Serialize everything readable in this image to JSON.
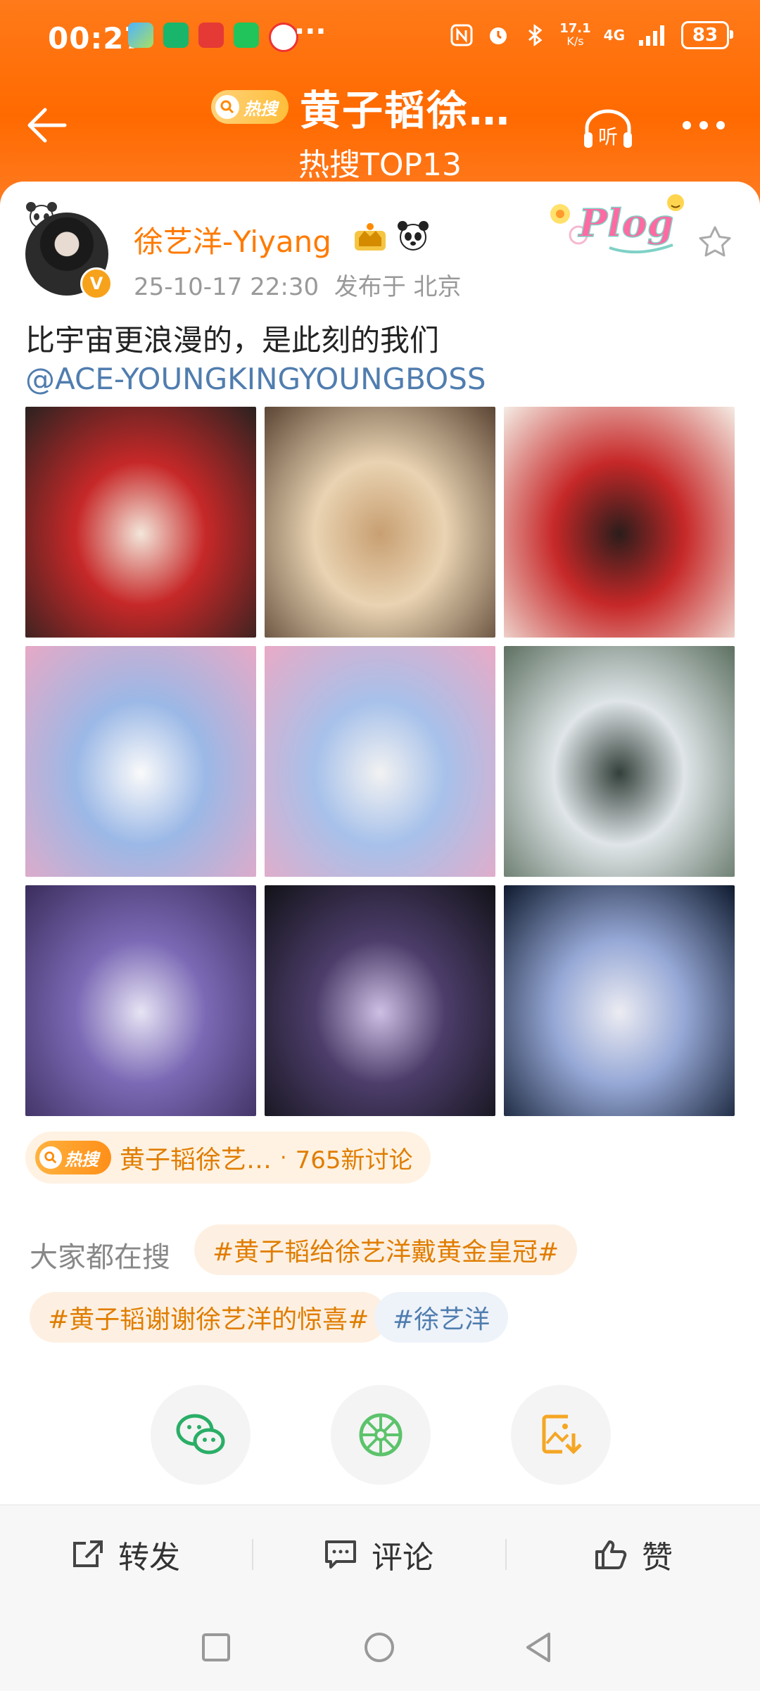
{
  "status_bar": {
    "time": "00:27",
    "more": "···",
    "net_speed": "17.1",
    "net_unit": "K/s",
    "network": "4G",
    "battery": "83"
  },
  "nav": {
    "hot_badge": "热搜",
    "title": "黄子韬徐…",
    "subtitle": "热搜TOP13",
    "listen_label": "听"
  },
  "post": {
    "author": "徐艺洋-Yiyang",
    "verified": "V",
    "timestamp": "25-10-17 22:30",
    "location": "发布于 北京",
    "text": "比宇宙更浪漫的，是此刻的我们",
    "mention": "@ACE-YOUNGKINGYOUNGBOSS",
    "plog_sticker": "Plog",
    "photos": [
      {
        "name": "photo-crown-ceremony",
        "colors": [
          "#2a2220",
          "#c62828",
          "#f3e6da"
        ]
      },
      {
        "name": "photo-veil",
        "colors": [
          "#5b4534",
          "#e9d3b2",
          "#c89f72"
        ]
      },
      {
        "name": "photo-bride-closeup",
        "colors": [
          "#f4ece4",
          "#c62828",
          "#2b1d1b"
        ]
      },
      {
        "name": "photo-flower-wall-couple",
        "colors": [
          "#e7a9c6",
          "#9bb8e6",
          "#fafafa"
        ]
      },
      {
        "name": "photo-flower-wall-kiss",
        "colors": [
          "#e9aac6",
          "#a7c1ea",
          "#f2f2f2"
        ]
      },
      {
        "name": "photo-outdoor-aisle",
        "colors": [
          "#5d7061",
          "#dfe5e8",
          "#33403a"
        ]
      },
      {
        "name": "photo-stage-galaxy",
        "colors": [
          "#3b2d5c",
          "#7b69b5",
          "#e7e4f4"
        ]
      },
      {
        "name": "photo-spotlight-stage",
        "colors": [
          "#121218",
          "#4c3d6a",
          "#cdbfe4"
        ]
      },
      {
        "name": "photo-walk-down",
        "colors": [
          "#0f1a2e",
          "#96a8d6",
          "#ececf2"
        ]
      }
    ]
  },
  "hot_topic": {
    "badge": "热搜",
    "name": "黄子韬徐艺…",
    "separator": "·",
    "count": "765新讨论"
  },
  "related": {
    "label": "大家都在搜",
    "tags": [
      {
        "text": "#黄子韬给徐艺洋戴黄金皇冠#",
        "style": "orange"
      },
      {
        "text": "#黄子韬谢谢徐艺洋的惊喜#",
        "style": "orange"
      },
      {
        "text": "#徐艺洋",
        "style": "blue"
      }
    ]
  },
  "share_targets": [
    "wechat-icon",
    "moments-icon",
    "save-image-icon"
  ],
  "actions": {
    "repost": "转发",
    "comment": "评论",
    "like": "赞"
  },
  "colors": {
    "brand_orange": "#ff6a00",
    "link_blue": "#507daf",
    "topic_orange": "#e07d00"
  }
}
